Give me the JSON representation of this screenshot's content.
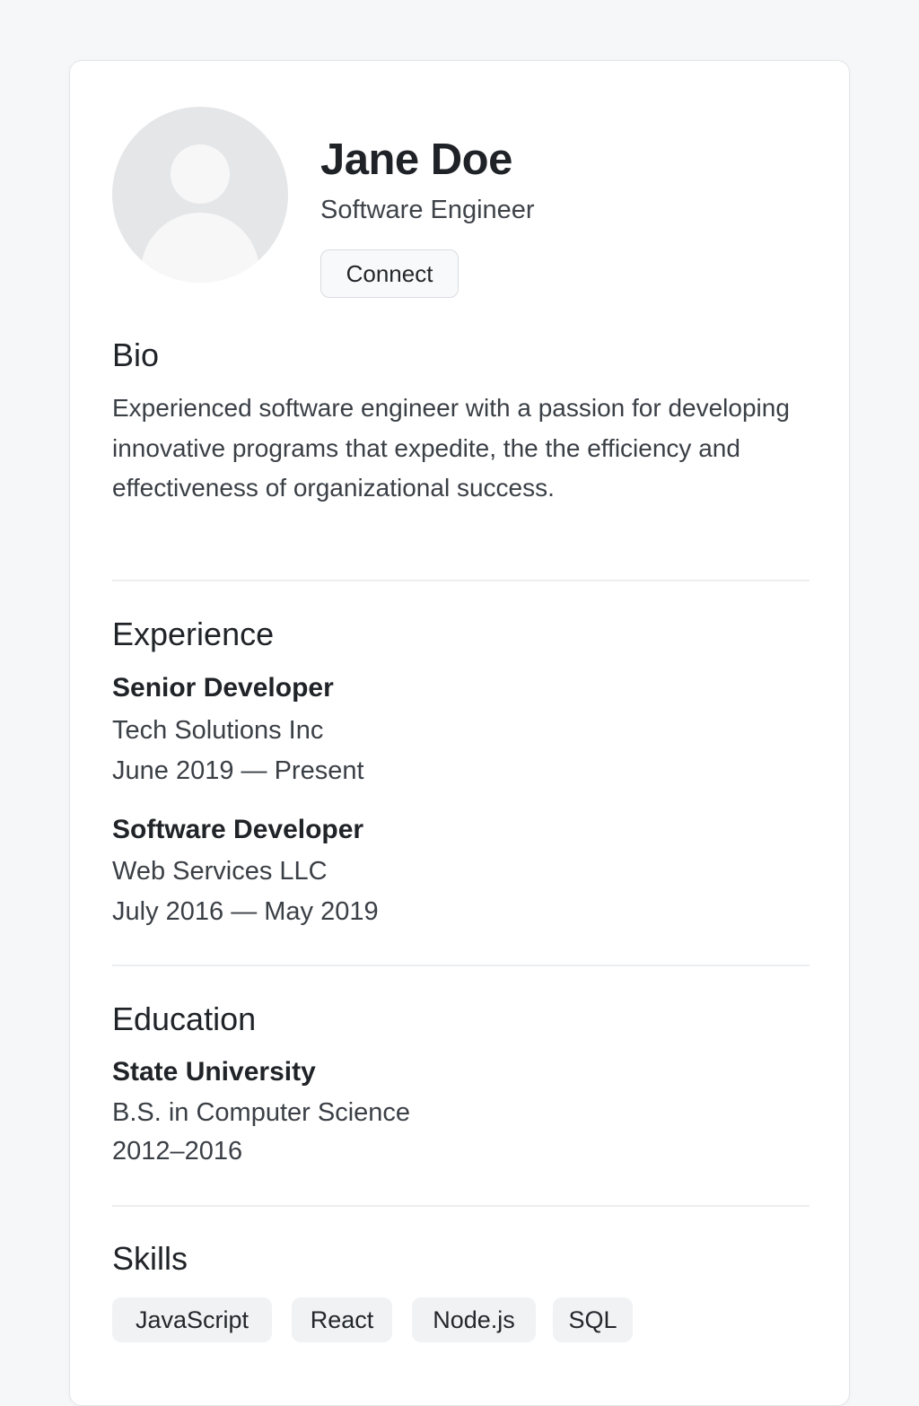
{
  "profile": {
    "name": "Jane Doe",
    "role": "Software Engineer",
    "connect_label": "Connect",
    "avatar_icon": "user-placeholder-icon"
  },
  "bio": {
    "title": "Bio",
    "text": "Experienced software engineer with a passion for developing innovative programs that expedite, the the efficiency and effectiveness of organizational success."
  },
  "experience": {
    "title": "Experience",
    "items": [
      {
        "position": "Senior Developer",
        "company": "Tech Solutions Inc",
        "dates": "June 2019  —  Present"
      },
      {
        "position": "Software Developer",
        "company": "Web Services LLC",
        "dates": "July 2016 — May 2019"
      }
    ]
  },
  "education": {
    "title": "Education",
    "school": "State University",
    "degree": "B.S. in Computer Science",
    "years": "2012–2016"
  },
  "skills": {
    "title": "Skills",
    "items": [
      "JavaScript",
      "React",
      "Node.js",
      "SQL"
    ]
  },
  "colors": {
    "background": "#f6f7f8",
    "card": "#ffffff",
    "text_primary": "#202327",
    "text_secondary": "#3b4046",
    "tag_background": "#f1f2f4",
    "avatar_background": "#e5e6e8"
  }
}
